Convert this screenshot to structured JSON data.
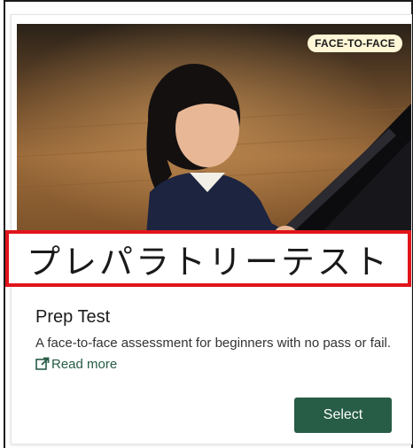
{
  "card": {
    "badge": "FACE-TO-FACE",
    "overlay_text": "プレパラトリーテスト",
    "title": "Prep Test",
    "description": "A face-to-face assessment for beginners with no pass or fail.",
    "read_more_label": "Read more",
    "read_more_icon": "external-link-icon",
    "select_label": "Select",
    "image_alt_icon": "child-playing-piano-photo"
  },
  "colors": {
    "accent": "#275c46",
    "badge_bg": "#fff6d6",
    "highlight_border": "#e0141b"
  }
}
